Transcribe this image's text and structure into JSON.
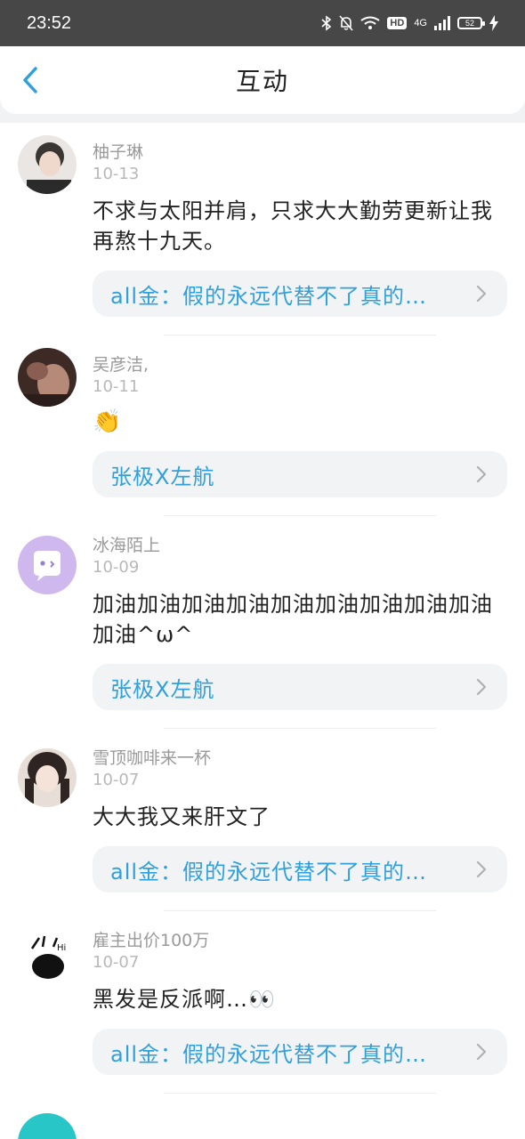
{
  "status_bar": {
    "time": "23:52",
    "network": "4G",
    "hd": "HD",
    "battery": "52",
    "icons": [
      "bluetooth-icon",
      "bell-off-icon",
      "wifi-icon",
      "hd-icon",
      "signal-icon",
      "battery-icon",
      "charging-icon"
    ]
  },
  "header": {
    "title": "互动",
    "back_icon": "chevron-left-icon",
    "accent": "#2fa0dc"
  },
  "items": [
    {
      "name": "柚子琳",
      "date": "10-13",
      "text": "不求与太阳并肩，只求大大勤劳更新让我再熬十九天。",
      "ref": "all金：假的永远代替不了真的…"
    },
    {
      "name": "吴彦洁,",
      "date": "10-11",
      "emoji": "👏",
      "ref": "张极X左航"
    },
    {
      "name": "冰海陌上",
      "date": "10-09",
      "text": "加油加油加油加油加油加油加油加油加油加油^ω^",
      "ref": "张极X左航"
    },
    {
      "name": "雪顶咖啡来一杯",
      "date": "10-07",
      "text": "大大我又来肝文了",
      "ref": "all金：假的永远代替不了真的…"
    },
    {
      "name": "雇主出价100万",
      "date": "10-07",
      "text": "黑发是反派啊…👀",
      "ref": "all金：假的永远代替不了真的…"
    }
  ]
}
